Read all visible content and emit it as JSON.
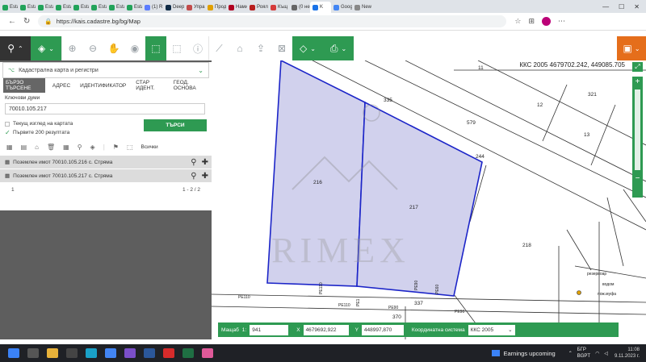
{
  "browser": {
    "tabs": [
      {
        "label": "Estat",
        "color": "#22a35a"
      },
      {
        "label": "Estat",
        "color": "#22a35a"
      },
      {
        "label": "Estat",
        "color": "#22a35a"
      },
      {
        "label": "Estat",
        "color": "#22a35a"
      },
      {
        "label": "Estat",
        "color": "#22a35a"
      },
      {
        "label": "Estat",
        "color": "#22a35a"
      },
      {
        "label": "Estat",
        "color": "#22a35a"
      },
      {
        "label": "Estat",
        "color": "#22a35a"
      },
      {
        "label": "(1) R",
        "color": "#5b7cff"
      },
      {
        "label": "Deep",
        "color": "#0f2b46"
      },
      {
        "label": "Упра",
        "color": "#c24b4b"
      },
      {
        "label": "Прод",
        "color": "#e0a000"
      },
      {
        "label": "Нами",
        "color": "#b00020"
      },
      {
        "label": "Роял",
        "color": "#b81f1f"
      },
      {
        "label": "Къщ",
        "color": "#d53b3b"
      },
      {
        "label": "(0 не",
        "color": "#666666"
      },
      {
        "label": "K",
        "color": "#1a73e8",
        "active": true
      },
      {
        "label": "Goog",
        "color": "#4285f4"
      },
      {
        "label": "New",
        "color": "#888888"
      }
    ],
    "url": "https://kais.cadastre.bg/bg/Map"
  },
  "sidebar": {
    "layer_select": "Кадастрална карта и регистри",
    "tabs": [
      "БЪРЗО ТЪРСЕНЕ",
      "АДРЕС",
      "ИДЕНТИФИКАТОР",
      "СТАР ИДЕНТ.",
      "ГЕОД. ОСНОВА"
    ],
    "keywords_label": "Ключови думи",
    "keywords_value": "70010.105.217",
    "opt_current_view": "Текущ изглед на картата",
    "opt_first_200": "Първите 200 резултата",
    "search_button": "ТЪРСИ",
    "all_label": "Всички",
    "results": [
      "Поземлен имот 70010.105.216 с. Стряма",
      "Поземлен имот 70010.105.217 с. Стряма"
    ],
    "pager_first": "1",
    "pager_count": "1 - 2 / 2"
  },
  "map": {
    "coord_readout": "ККС 2005 4679702.242, 449085.705",
    "watermark": "RIMEX",
    "labels": [
      "11",
      "12",
      "13",
      "335",
      "579",
      "321",
      "244",
      "216",
      "217",
      "218",
      "337",
      "370",
      "PE110",
      "PE110",
      "PE90",
      "PE90",
      "PE1",
      "PE110",
      "PE90",
      "PE60",
      "резервоар",
      "водом",
      "пож.муфа"
    ],
    "parcel_fill": "#c9c9ea",
    "parcel_stroke": "#1c25c8"
  },
  "footer": {
    "scale_label": "Мащаб",
    "scale_prefix": "1:",
    "scale_value": "941",
    "x_label": "X",
    "x_value": "4679692,922",
    "y_label": "Y",
    "y_value": "448997,870",
    "crs_label": "Координатна система",
    "crs_value": "ККС 2005"
  },
  "taskbar": {
    "news": "Earnings upcoming",
    "lang1": "БГР",
    "lang2": "BGPT",
    "time": "11:08",
    "date": "9.11.2023 г."
  }
}
